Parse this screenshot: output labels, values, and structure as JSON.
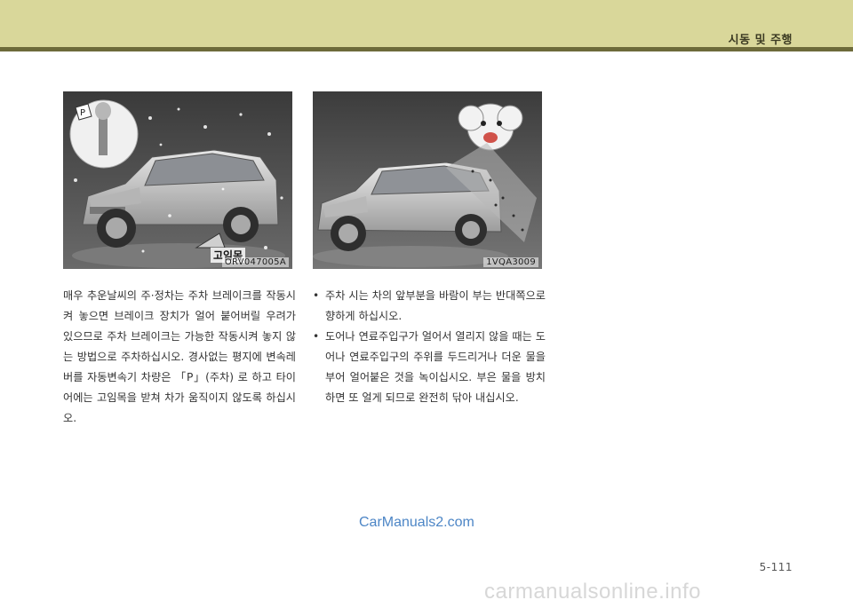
{
  "header": {
    "section_title": "시동 및 주행"
  },
  "figures": {
    "left": {
      "code": "ORV047005A",
      "callout": "고임목"
    },
    "right": {
      "code": "1VQA3009"
    }
  },
  "left_column": {
    "paragraph": "매우 추운날씨의 주·정차는 주차 브레이크를 작동시켜 놓으면 브레이크 장치가 얼어 붙어버릴 우려가 있으므로 주차 브레이크는 가능한 작동시켜 놓지 않는 방법으로 주차하십시오.  경사없는 평지에 변속레버를 자동변속기 차량은 「P」(주차) 로 하고 타이어에는 고임목을 받쳐 차가 움직이지 않도록 하십시오."
  },
  "right_column": {
    "bullets": [
      "주차 시는 차의 앞부분을 바람이 부는 반대쪽으로 향하게 하십시오.",
      "도어나 연료주입구가 얼어서 열리지 않을 때는 도어나 연료주입구의 주위를 두드리거나 더운 물을 부어 얼어붙은 것을 녹이십시오.  부은 물을 방치하면 또 얼게 되므로 완전히 닦아 내십시오."
    ],
    "bullet_glyph": "•"
  },
  "watermark": "CarManuals2.com",
  "page_number": "5-111",
  "footer_mark": "carmanualsonline.info",
  "colors": {
    "header_band": "#d9d79a",
    "header_rule": "#6d6a3a",
    "watermark": "#4d86c6"
  }
}
